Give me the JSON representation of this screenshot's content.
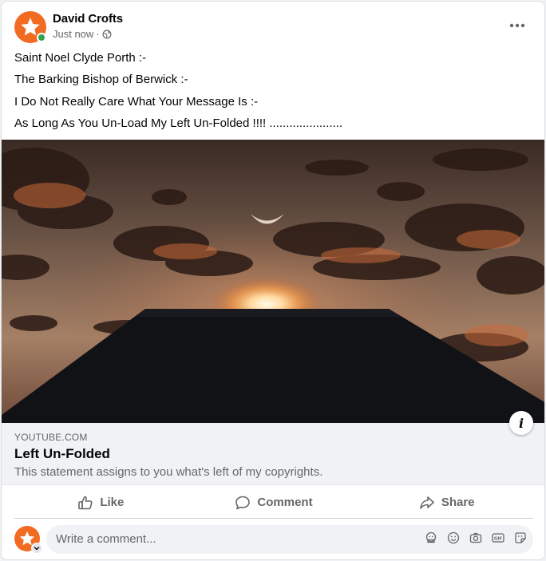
{
  "post": {
    "author": "David Crofts",
    "timestamp": "Just now",
    "separator": "·",
    "audience_icon": "globe-icon",
    "menu_icon": "more-options-icon",
    "text_lines": [
      "Saint Noel Clyde Porth :-",
      "The Barking Bishop of Berwick :-",
      "I Do Not Really Care What Your Message Is :-",
      "As Long As You Un-Load My Left Un-Folded !!!! ......................"
    ]
  },
  "link": {
    "domain": "YOUTUBE.COM",
    "title": "Left Un-Folded",
    "description": "This statement assigns to you what's left of my copyrights.",
    "info_icon": "i"
  },
  "actions": {
    "like": "Like",
    "comment": "Comment",
    "share": "Share"
  },
  "comment": {
    "placeholder": "Write a comment...",
    "icons": [
      "avatar-sticker-icon",
      "emoji-icon",
      "camera-icon",
      "gif-icon",
      "sticker-icon"
    ]
  },
  "colors": {
    "accent": "#f26b22",
    "online": "#31a24c",
    "secondary_text": "#65676b"
  }
}
